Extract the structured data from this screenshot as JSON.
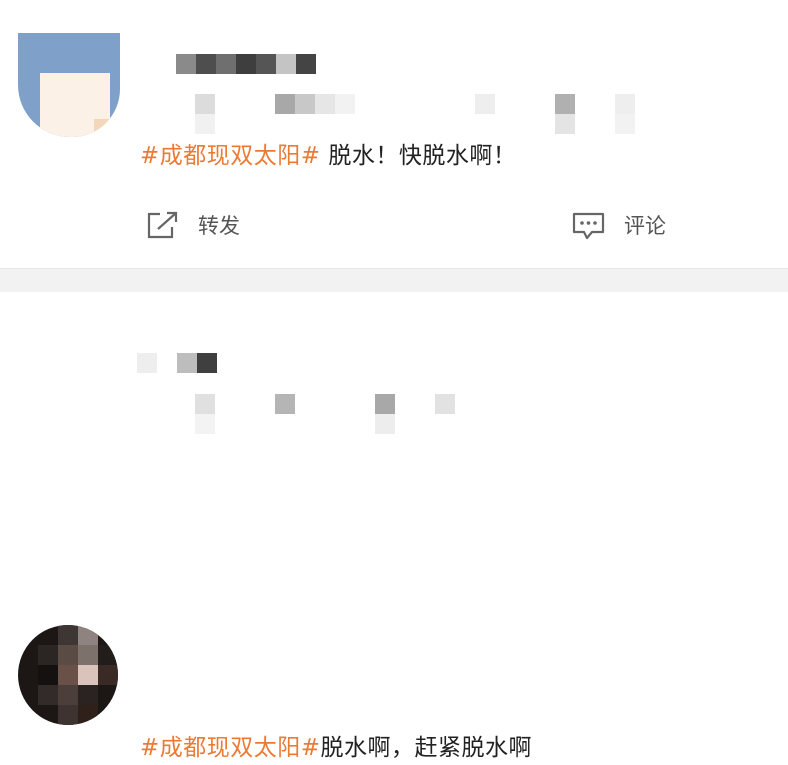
{
  "posts": [
    {
      "topic": "#成都现双太阳#",
      "text": " 脱水！快脱水啊！",
      "actions": {
        "share_label": "转发",
        "comment_label": "评论"
      }
    },
    {
      "topic": "#成都现双太阳#",
      "text": "脱水啊，赶紧脱水啊"
    }
  ],
  "colors": {
    "topic": "#eb7a35",
    "divider": "#f2f2f2",
    "text": "#222222",
    "action": "#555555"
  },
  "icons": [
    "share-icon",
    "comment-icon"
  ]
}
